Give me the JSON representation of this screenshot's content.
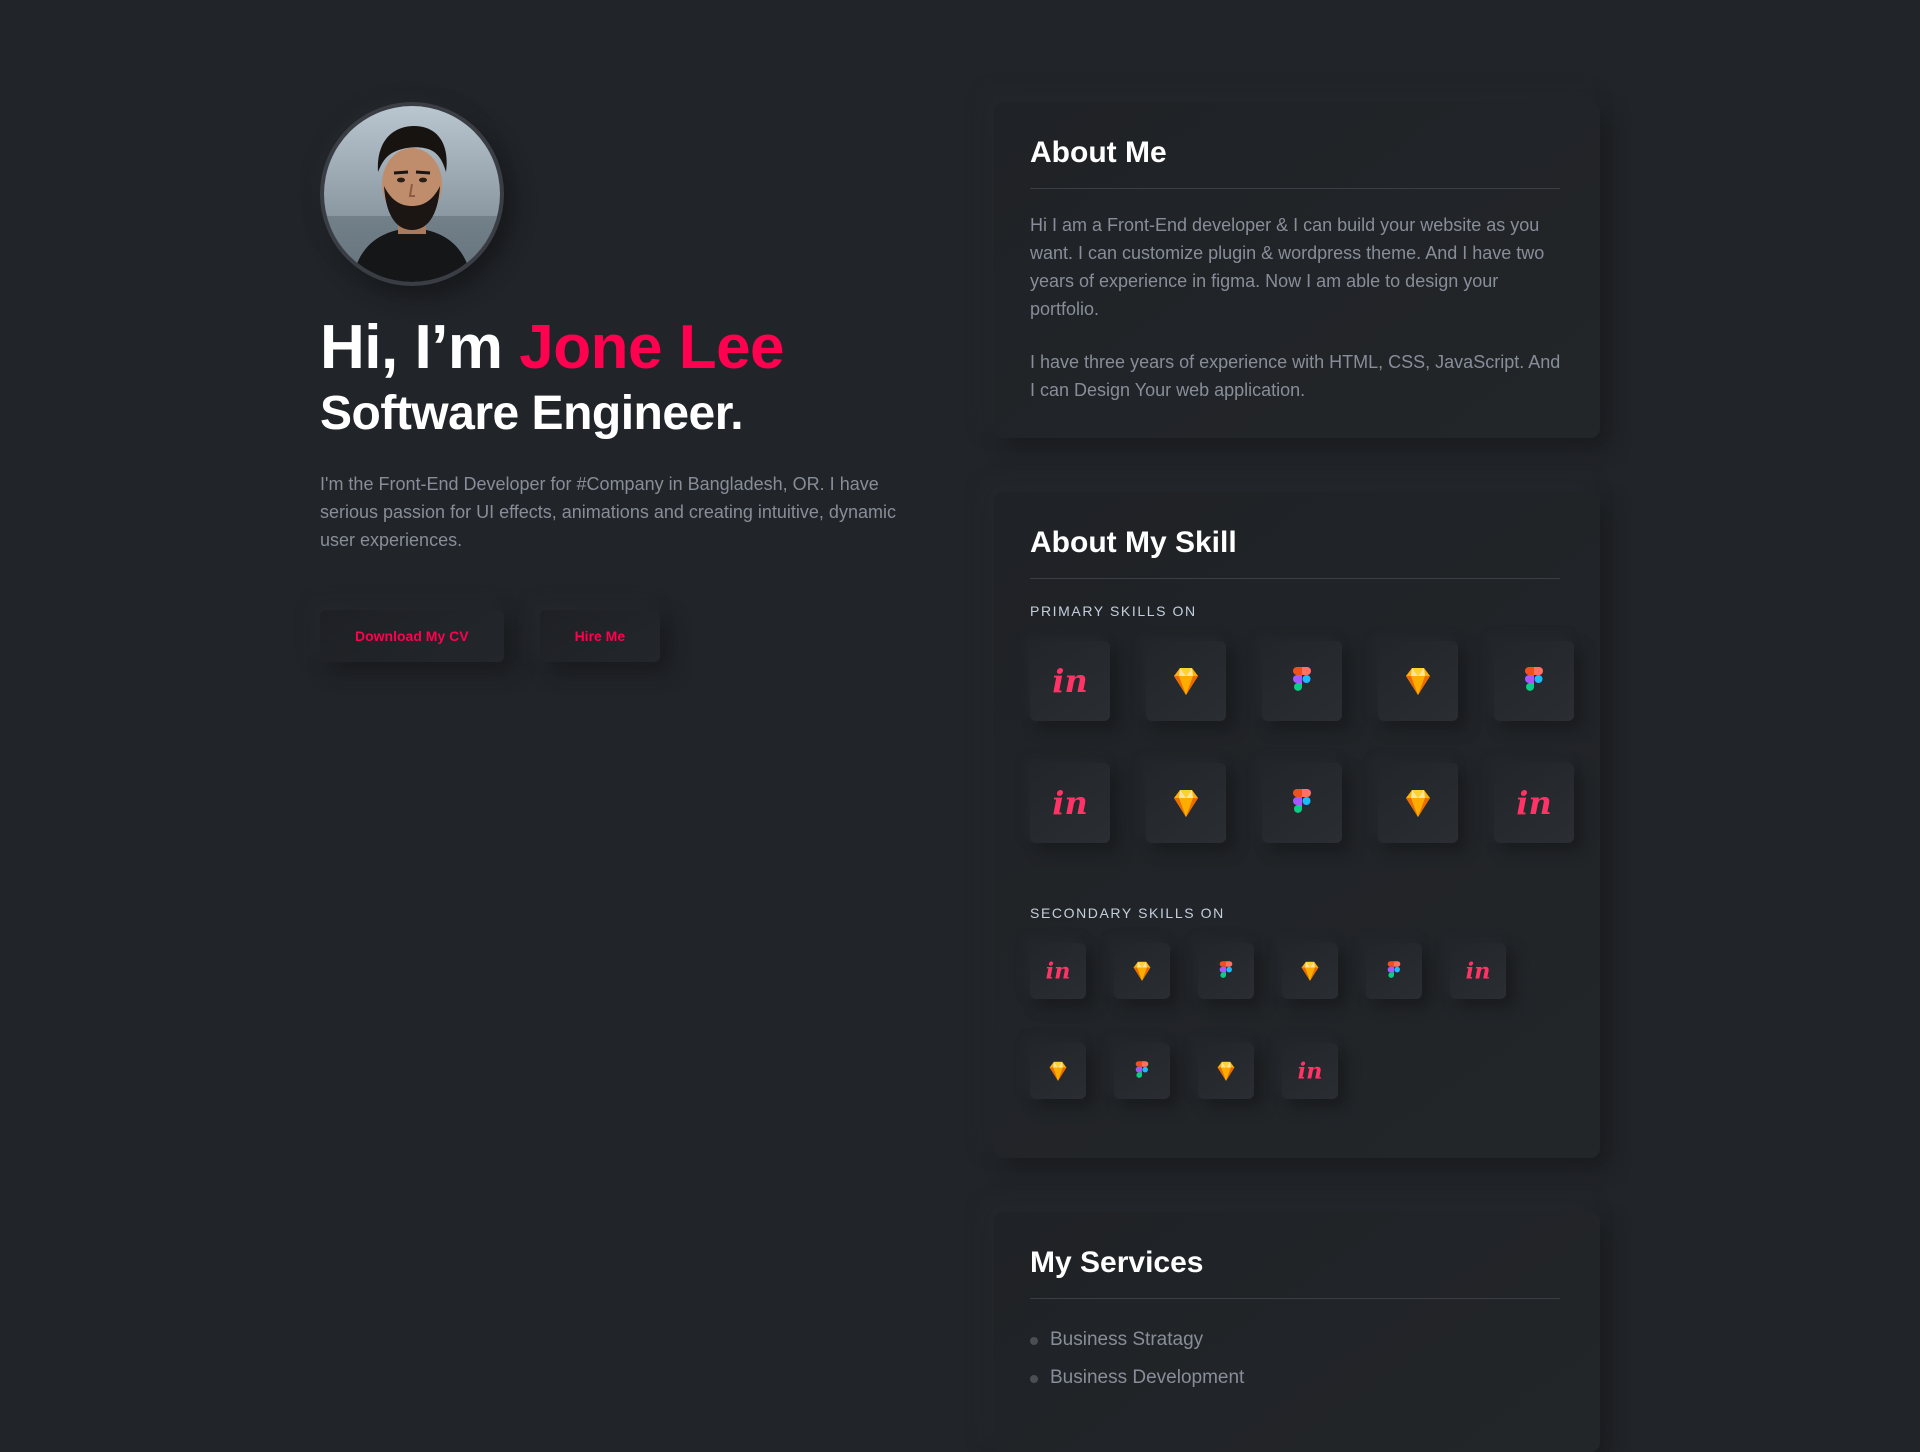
{
  "hero": {
    "greeting": "Hi, I’m ",
    "name": "Jone Lee",
    "role": "Software Engineer.",
    "intro": "I'm the Front-End Developer for #Company in Bangladesh, OR. I have serious passion for UI effects, animations and creating intuitive, dynamic user experiences.",
    "buttons": {
      "download_cv": "Download My CV",
      "hire_me": "Hire Me"
    }
  },
  "about": {
    "title": "About Me",
    "paragraphs": [
      "Hi I am a Front-End developer & I can build your website as you want. I can customize plugin & wordpress theme. And I have two years of experience in figma. Now I am able to design your portfolio.",
      "I have three years of experience with HTML, CSS, JavaScript. And I can Design Your web application."
    ]
  },
  "skills": {
    "title": "About My Skill",
    "primary_label": "PRIMARY SKILLS ON",
    "primary_icons": [
      "invision-icon",
      "sketch-icon",
      "figma-icon",
      "sketch-icon",
      "figma-icon",
      "invision-icon",
      "sketch-icon",
      "figma-icon",
      "sketch-icon",
      "invision-icon"
    ],
    "secondary_label": "SECONDARY SKILLS ON",
    "secondary_icons": [
      "invision-icon",
      "sketch-icon",
      "figma-icon",
      "sketch-icon",
      "figma-icon",
      "invision-icon",
      "sketch-icon",
      "figma-icon",
      "sketch-icon",
      "invision-icon"
    ]
  },
  "services": {
    "title": "My Services",
    "items": [
      "Business Stratagy",
      "Business Development"
    ]
  },
  "colors": {
    "background": "#212428",
    "accent": "#ff014f",
    "heading": "#ffffff",
    "body_text": "#878e99"
  }
}
